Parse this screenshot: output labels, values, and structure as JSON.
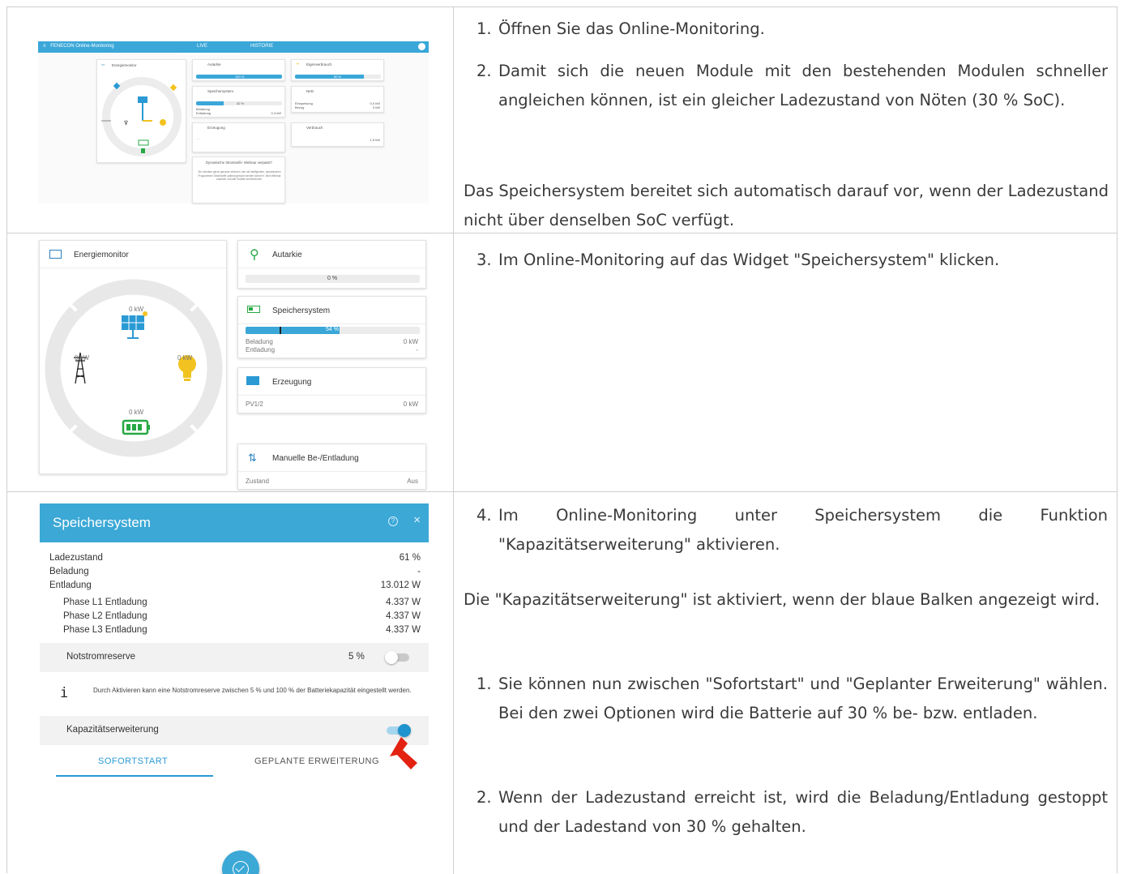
{
  "row1": {
    "screenshot": {
      "app_title": "FENECON Online-Monitoring",
      "tab_live": "LIVE",
      "tab_history": "HISTORIE",
      "energymonitor": "Energiemonitor",
      "autarkie": "Autarkie",
      "autarkie_value": "100 %",
      "eigenverbrauch": "Eigenverbrauch",
      "eigen_value": "80 %",
      "speichersystem": "Speichersystem",
      "speicher_value": "32 %",
      "beladung": "Beladung",
      "entladung": "Entladung",
      "entladung_value": "0,3 kW",
      "netz": "Netz",
      "einspeisung": "Einspeisung",
      "einspeisung_value": "0,0 kW",
      "bezug": "Bezug",
      "bezug_value": "0 kW",
      "erzeugung": "Erzeugung",
      "verbrauch": "Verbrauch",
      "verbrauch_value": "1,5 kW",
      "webinar_title": "Dynamische Stromtarife: Webinar verpasst?",
      "webinar_text": "Sie möchten gerne genauer erfahren, wie mit intelligenten, dynamischen Programmen Stromtarife optimal genutzt werden können? Jetzt Webinar ansehen und alle Vorteile kennenlernen."
    },
    "steps": [
      {
        "num": "1.",
        "text": "Öffnen Sie das Online-Monitoring."
      },
      {
        "num": "2.",
        "text": "Damit sich die neuen Module mit den bestehenden Modulen schneller angleichen können, ist ein gleicher Ladezustand von Nöten (30 % SoC)."
      }
    ],
    "note": "Das Speichersystem bereitet sich automatisch darauf vor, wenn der Ladezustand nicht über denselben SoC verfügt."
  },
  "row2": {
    "screenshot": {
      "energymonitor": "Energiemonitor",
      "pv_kw": "0 kW",
      "grid_kw": "0 kW",
      "cons_kw": "0 kW",
      "bat_kw": "0 kW",
      "autarkie": "Autarkie",
      "autarkie_value": "0 %",
      "speichersystem": "Speichersystem",
      "speicher_value": "54 %",
      "beladung": "Beladung",
      "beladung_value": "0 kW",
      "entladung": "Entladung",
      "entladung_value": "-",
      "erzeugung": "Erzeugung",
      "pv_label": "PV1/2",
      "pv_value": "0 kW",
      "manuell": "Manuelle Be-/Entladung",
      "zustand": "Zustand",
      "zustand_value": "Aus"
    },
    "steps": [
      {
        "num": "3.",
        "text": "Im Online-Monitoring auf das Widget \"Speichersystem\" klicken."
      }
    ]
  },
  "row3": {
    "modal": {
      "title": "Speichersystem",
      "rows": [
        {
          "label": "Ladezustand",
          "value": "61 %"
        },
        {
          "label": "Beladung",
          "value": "-"
        },
        {
          "label": "Entladung",
          "value": "13.012 W"
        },
        {
          "label": "Phase L1 Entladung",
          "value": "4.337 W"
        },
        {
          "label": "Phase L2 Entladung",
          "value": "4.337 W"
        },
        {
          "label": "Phase L3 Entladung",
          "value": "4.337 W"
        }
      ],
      "notstrom_label": "Notstromreserve",
      "notstrom_value": "5 %",
      "info_text": "Durch Aktivieren kann eine Notstromreserve zwischen 5 % und 100 % der Batteriekapazität eingestellt werden.",
      "kapazitaet_label": "Kapazitätserweiterung",
      "tab_sofort": "SOFORTSTART",
      "tab_geplant": "GEPLANTE ERWEITERUNG"
    },
    "step4": {
      "num": "4.",
      "text": "Im Online-Monitoring unter Speichersystem die Funktion \"Kapazitätserweiterung\" aktivieren."
    },
    "note": "Die \"Kapazitätserweiterung\" ist aktiviert, wenn der blaue Balken angezeigt wird.",
    "substeps": [
      {
        "num": "1.",
        "text": "Sie können nun zwischen \"Sofortstart\" und \"Geplanter Erweiterung\" wählen. Bei den zwei Optionen wird die Batterie auf 30 % be- bzw. entladen."
      },
      {
        "num": "2.",
        "text": "Wenn der Ladezustand erreicht ist, wird die Beladung/Entladung gestoppt und der Ladestand von 30 % gehalten."
      }
    ]
  }
}
